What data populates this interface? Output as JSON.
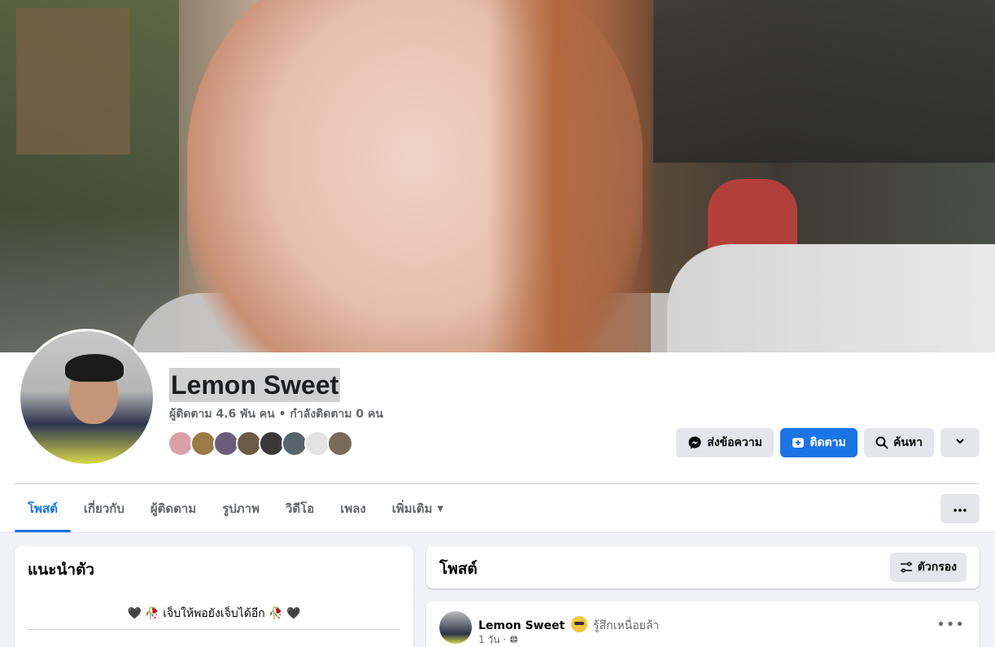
{
  "profile": {
    "name": "Lemon Sweet",
    "stats": "ผู้ติดตาม 4.6 พัน คน • กำลังติดตาม 0 คน"
  },
  "friends_preview": [
    {
      "color": "#d9a0a8"
    },
    {
      "color": "#9a7a46"
    },
    {
      "color": "#6b5d7a"
    },
    {
      "color": "#6b5a44"
    },
    {
      "color": "#3a3a3a"
    },
    {
      "color": "#58646b"
    },
    {
      "color": "#e3e3e3"
    },
    {
      "color": "#7a6a5a"
    }
  ],
  "actions": {
    "message_label": "ส่งข้อความ",
    "follow_label": "ติดตาม",
    "search_label": "ค้นหา"
  },
  "tabs": [
    {
      "label": "โพสต์"
    },
    {
      "label": "เกี่ยวกับ"
    },
    {
      "label": "ผู้ติดตาม"
    },
    {
      "label": "รูปภาพ"
    },
    {
      "label": "วิดีโอ"
    },
    {
      "label": "เพลง"
    },
    {
      "label": "เพิ่มเติม"
    }
  ],
  "intro": {
    "title": "แนะนำตัว",
    "bio": "🖤 🥀 เจ็บให้พอยังเจ็บได้อีก 🥀 🖤"
  },
  "posts": {
    "title": "โพสต์",
    "filter_label": "ตัวกรอง"
  },
  "post": {
    "author": "Lemon Sweet",
    "feeling": "รู้สึกเหนื่อยล้า",
    "time": "1 วัน ·"
  },
  "colors": {
    "accent": "#1b74e4",
    "button_gray": "#e4e6eb",
    "text_secondary": "#65676b"
  }
}
